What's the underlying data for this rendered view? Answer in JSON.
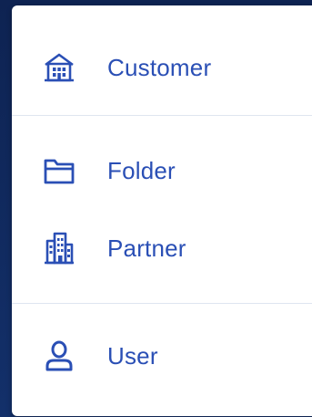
{
  "menu": {
    "items": [
      {
        "label": "Customer",
        "icon": "building-icon"
      },
      {
        "label": "Folder",
        "icon": "folder-icon"
      },
      {
        "label": "Partner",
        "icon": "office-building-icon"
      },
      {
        "label": "User",
        "icon": "user-icon"
      }
    ]
  },
  "colors": {
    "accent": "#2a4fb5",
    "background": "#0f2657",
    "divider": "#dfe5f0"
  }
}
